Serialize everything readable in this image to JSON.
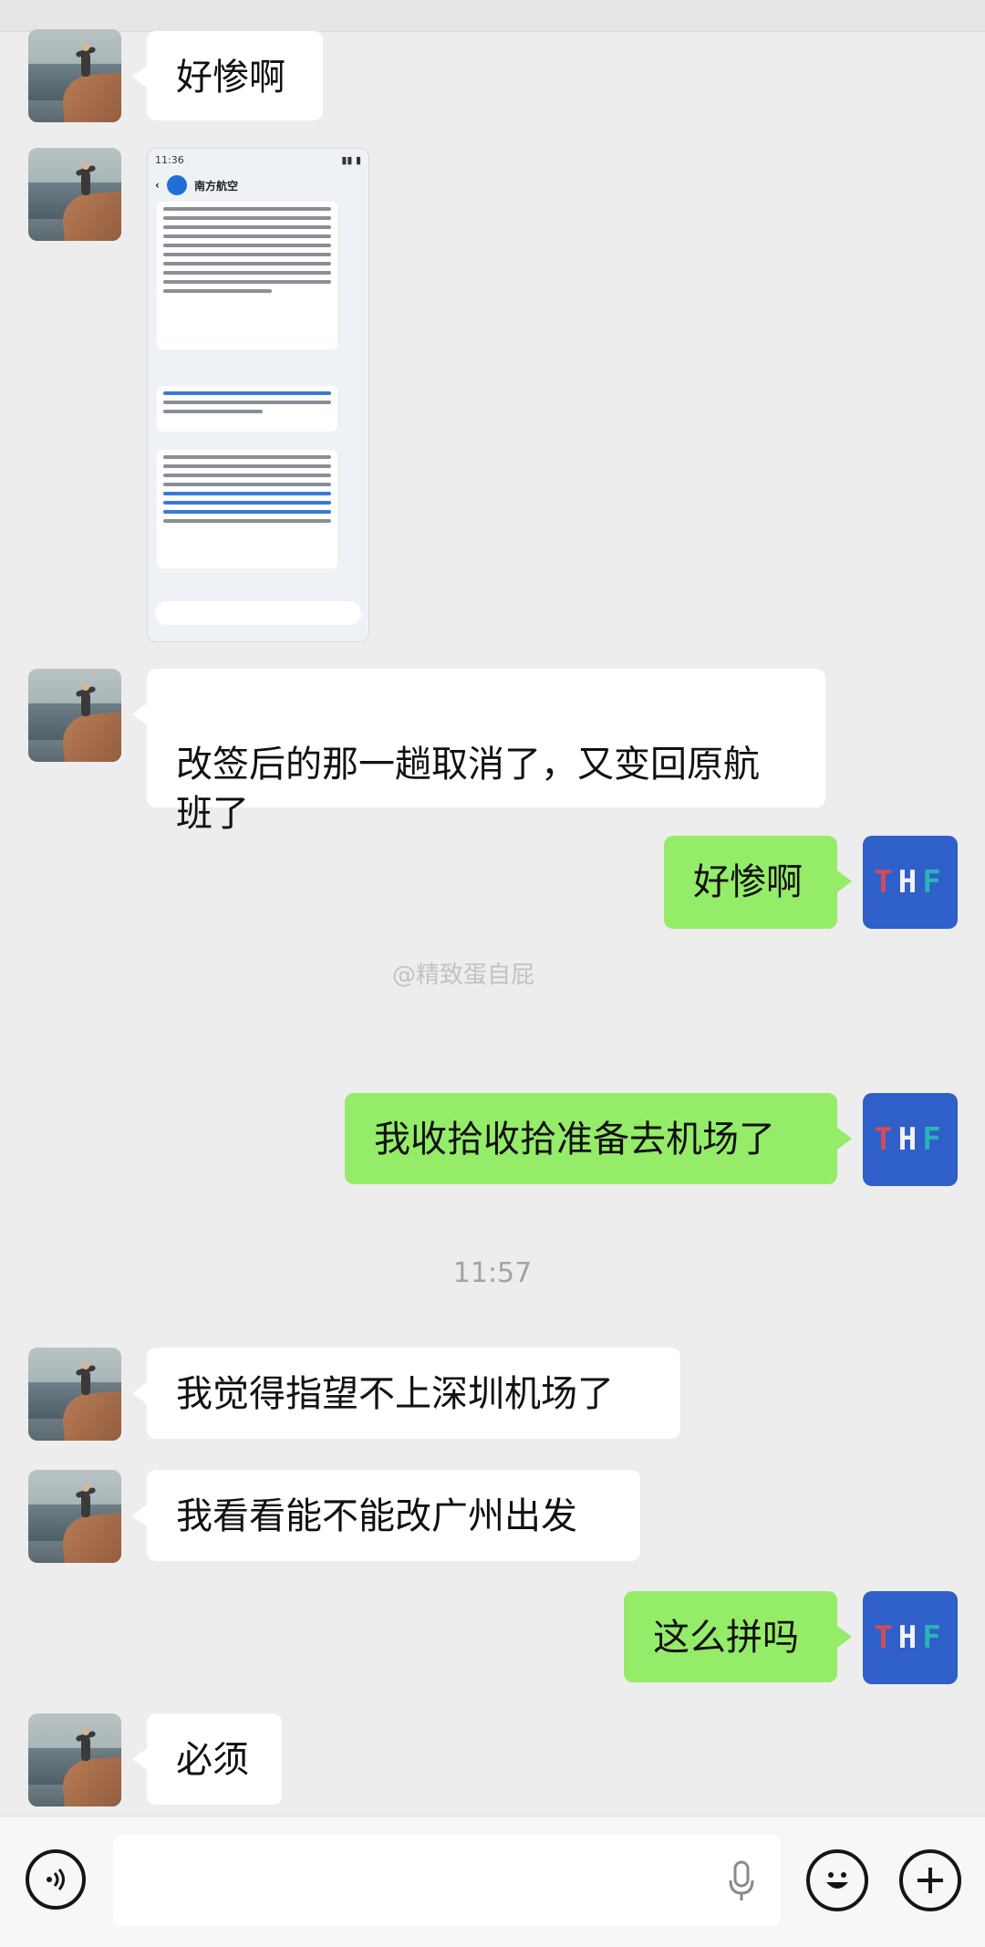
{
  "messages": [
    {
      "side": "left",
      "text": "好惨啊"
    },
    {
      "side": "left",
      "type": "image"
    },
    {
      "side": "left",
      "text": "改签后的那一趟取消了，又变回原航\n班了"
    },
    {
      "side": "right",
      "text": "好惨啊"
    },
    {
      "side": "right",
      "text": "我收拾收拾准备去机场了"
    },
    {
      "side": "left",
      "text": "我觉得指望不上深圳机场了"
    },
    {
      "side": "left",
      "text": "我看看能不能改广州出发"
    },
    {
      "side": "right",
      "text": "这么拼吗"
    },
    {
      "side": "left",
      "text": "必须"
    }
  ],
  "timestamp": "11:57",
  "watermark": "@精致蛋自屁",
  "screenshot_in_image": {
    "status_time": "11:36",
    "account_name": "南方航空"
  },
  "my_avatar_text": {
    "t": "T",
    "h": "H",
    "f": "F"
  },
  "bottom_bar": {
    "left_icon": "voice-icon",
    "mic_icon": "microphone-icon",
    "emoji_icon": "emoji-icon",
    "plus_icon": "plus-icon"
  },
  "colors": {
    "background": "#ededed",
    "bubble_right": "#95ec69",
    "bubble_left": "#ffffff"
  }
}
